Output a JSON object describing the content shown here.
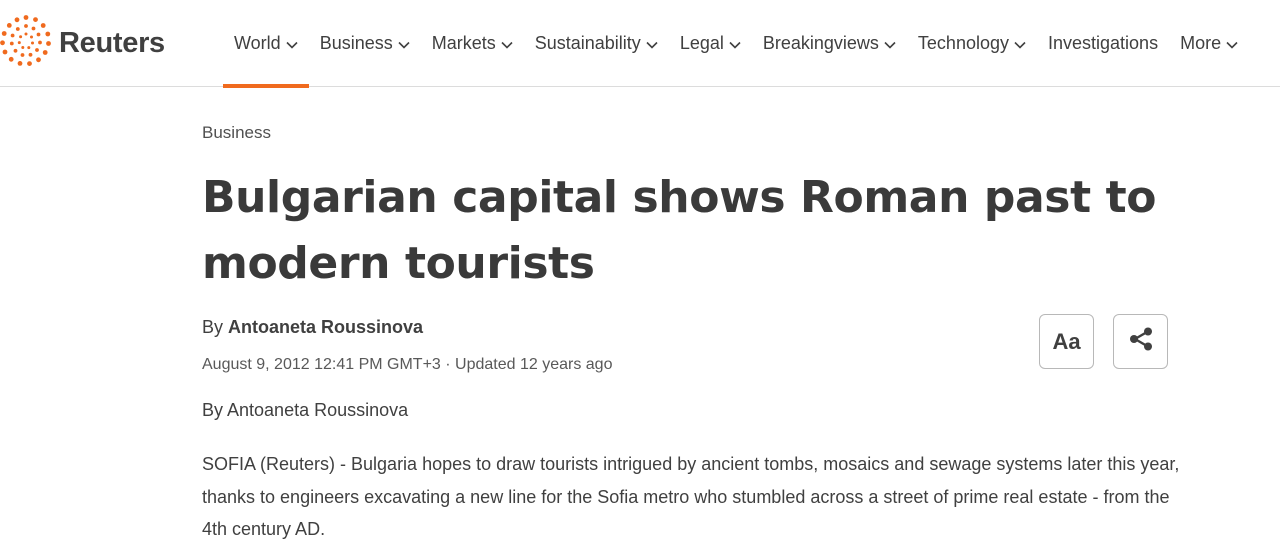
{
  "brand": {
    "name": "Reuters",
    "accent_color": "#f06a1e"
  },
  "nav": {
    "items": [
      {
        "label": "World",
        "has_dropdown": true,
        "active": true
      },
      {
        "label": "Business",
        "has_dropdown": true,
        "active": false
      },
      {
        "label": "Markets",
        "has_dropdown": true,
        "active": false
      },
      {
        "label": "Sustainability",
        "has_dropdown": true,
        "active": false
      },
      {
        "label": "Legal",
        "has_dropdown": true,
        "active": false
      },
      {
        "label": "Breakingviews",
        "has_dropdown": true,
        "active": false
      },
      {
        "label": "Technology",
        "has_dropdown": true,
        "active": false
      },
      {
        "label": "Investigations",
        "has_dropdown": false,
        "active": false
      },
      {
        "label": "More",
        "has_dropdown": true,
        "active": false
      }
    ],
    "dropdown_icon": "chevron-down-icon"
  },
  "article": {
    "section": "Business",
    "headline": "Bulgarian capital shows Roman past to modern tourists",
    "byline_prefix": "By ",
    "author": "Antoaneta Roussinova",
    "dateline": "August 9, 2012 12:41 PM GMT+3 · Updated 12 years ago",
    "body": {
      "byline": "By Antoaneta Roussinova",
      "paragraph_1": "SOFIA (Reuters) - Bulgaria hopes to draw tourists intrigued by ancient tombs, mosaics and sewage systems later this year, thanks to engineers excavating a new line for the Sofia metro who stumbled across a street of prime real estate - from the 4th century AD."
    }
  },
  "tools": {
    "text_size_label": "Aa",
    "share_icon": "share-icon"
  }
}
